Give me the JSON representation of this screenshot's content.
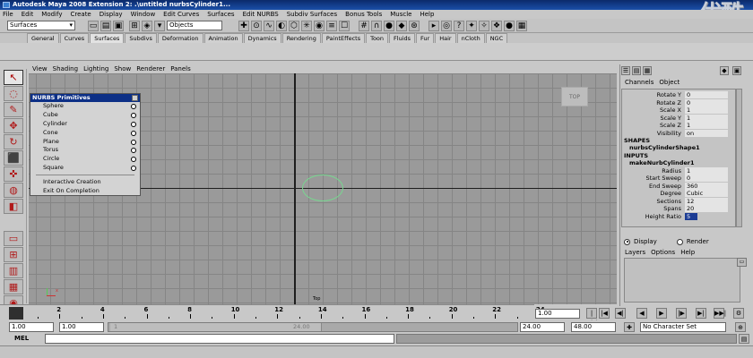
{
  "window": {
    "title": "Autodesk Maya 2008 Extension 2: .\\untitled    nurbsCylinder1...",
    "watermark": "优酷"
  },
  "menubar": [
    "File",
    "Edit",
    "Modify",
    "Create",
    "Display",
    "Window",
    "Edit Curves",
    "Surfaces",
    "Edit NURBS",
    "Subdiv Surfaces",
    "Bonus Tools",
    "Muscle",
    "Help"
  ],
  "statusline": {
    "mode": "Surfaces",
    "selection_mask": "Objects"
  },
  "shelf_tabs": [
    "General",
    "Curves",
    "Surfaces",
    "Subdivs",
    "Deformation",
    "Animation",
    "Dynamics",
    "Rendering",
    "PaintEffects",
    "Toon",
    "Fluids",
    "Fur",
    "Hair",
    "nCloth",
    "NGC"
  ],
  "panel_menu": [
    "View",
    "Shading",
    "Lighting",
    "Show",
    "Renderer",
    "Panels"
  ],
  "viewport": {
    "view_cube_label": "TOP",
    "camera_label": "Top"
  },
  "nurbs_menu": {
    "title": "NURBS Primitives",
    "items": [
      "Sphere",
      "Cube",
      "Cylinder",
      "Cone",
      "Plane",
      "Torus",
      "Circle",
      "Square"
    ],
    "extra_items": [
      "Interactive Creation",
      "Exit On Completion"
    ]
  },
  "channel_box": {
    "menu": [
      "Channels",
      "Object"
    ],
    "transform_attrs": [
      {
        "label": "Rotate Y",
        "value": "0"
      },
      {
        "label": "Rotate Z",
        "value": "0"
      },
      {
        "label": "Scale X",
        "value": "1"
      },
      {
        "label": "Scale Y",
        "value": "1"
      },
      {
        "label": "Scale Z",
        "value": "1"
      },
      {
        "label": "Visibility",
        "value": "on"
      }
    ],
    "shapes_header": "SHAPES",
    "shape_node": "nurbsCylinderShape1",
    "inputs_header": "INPUTS",
    "input_node": "makeNurbCylinder1",
    "input_attrs": [
      {
        "label": "Radius",
        "value": "1"
      },
      {
        "label": "Start Sweep",
        "value": "0"
      },
      {
        "label": "End Sweep",
        "value": "360"
      },
      {
        "label": "Degree",
        "value": "Cubic"
      },
      {
        "label": "Sections",
        "value": "12"
      },
      {
        "label": "Spans",
        "value": "20"
      },
      {
        "label": "Height Ratio",
        "value": "5"
      }
    ]
  },
  "layer_editor": {
    "display_label": "Display",
    "render_label": "Render",
    "menu": [
      "Layers",
      "Options",
      "Help"
    ]
  },
  "time_slider": {
    "tick_labels": [
      "2",
      "4",
      "6",
      "8",
      "10",
      "12",
      "14",
      "16",
      "18",
      "20",
      "22",
      "24"
    ],
    "current_frame": "1.00",
    "playback_buttons": [
      "|◀◀",
      "|◀",
      "◀|",
      "◀",
      "▶",
      "|▶",
      "▶|",
      "▶▶|"
    ]
  },
  "range_slider": {
    "start": "1.00",
    "playback_start": "1.00",
    "bar_left_label": "1",
    "bar_right_label": "24.00",
    "playback_end": "24.00",
    "end": "48.00",
    "character_set": "No Character Set"
  },
  "command_line": {
    "label": "MEL"
  }
}
